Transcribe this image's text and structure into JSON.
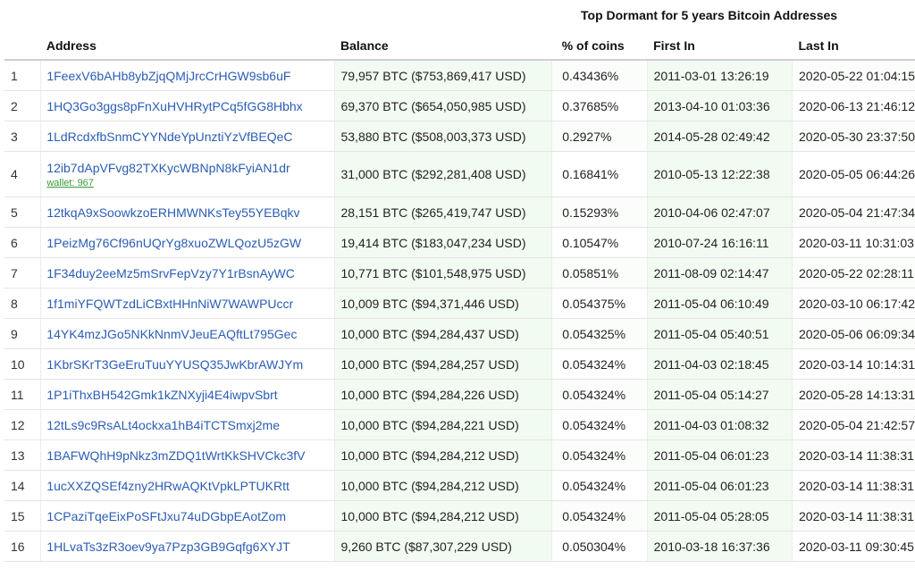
{
  "title": "Top Dormant for 5 years Bitcoin Addresses",
  "columns": {
    "address": "Address",
    "balance": "Balance",
    "pct": "% of coins",
    "first_in": "First In",
    "last_in": "Last In"
  },
  "rows": [
    {
      "idx": "1",
      "address": "1FeexV6bAHb8ybZjqQMjJrcCrHGW9sb6uF",
      "wallet": "",
      "balance": "79,957 BTC ($753,869,417 USD)",
      "pct": "0.43436%",
      "first_in": "2011-03-01 13:26:19",
      "last_in": "2020-05-22 01:04:15"
    },
    {
      "idx": "2",
      "address": "1HQ3Go3ggs8pFnXuHVHRytPCq5fGG8Hbhx",
      "wallet": "",
      "balance": "69,370 BTC ($654,050,985 USD)",
      "pct": "0.37685%",
      "first_in": "2013-04-10 01:03:36",
      "last_in": "2020-06-13 21:46:12"
    },
    {
      "idx": "3",
      "address": "1LdRcdxfbSnmCYYNdeYpUnztiYzVfBEQeC",
      "wallet": "",
      "balance": "53,880 BTC ($508,003,373 USD)",
      "pct": "0.2927%",
      "first_in": "2014-05-28 02:49:42",
      "last_in": "2020-05-30 23:37:50"
    },
    {
      "idx": "4",
      "address": "12ib7dApVFvg82TXKycWBNpN8kFyiAN1dr",
      "wallet": "wallet: 967",
      "balance": "31,000 BTC ($292,281,408 USD)",
      "pct": "0.16841%",
      "first_in": "2010-05-13 12:22:38",
      "last_in": "2020-05-05 06:44:26"
    },
    {
      "idx": "5",
      "address": "12tkqA9xSoowkzoERHMWNKsTey55YEBqkv",
      "wallet": "",
      "balance": "28,151 BTC ($265,419,747 USD)",
      "pct": "0.15293%",
      "first_in": "2010-04-06 02:47:07",
      "last_in": "2020-05-04 21:47:34"
    },
    {
      "idx": "6",
      "address": "1PeizMg76Cf96nUQrYg8xuoZWLQozU5zGW",
      "wallet": "",
      "balance": "19,414 BTC ($183,047,234 USD)",
      "pct": "0.10547%",
      "first_in": "2010-07-24 16:16:11",
      "last_in": "2020-03-11 10:31:03"
    },
    {
      "idx": "7",
      "address": "1F34duy2eeMz5mSrvFepVzy7Y1rBsnAyWC",
      "wallet": "",
      "balance": "10,771 BTC ($101,548,975 USD)",
      "pct": "0.05851%",
      "first_in": "2011-08-09 02:14:47",
      "last_in": "2020-05-22 02:28:11"
    },
    {
      "idx": "8",
      "address": "1f1miYFQWTzdLiCBxtHHnNiW7WAWPUccr",
      "wallet": "",
      "balance": "10,009 BTC ($94,371,446 USD)",
      "pct": "0.054375%",
      "first_in": "2011-05-04 06:10:49",
      "last_in": "2020-03-10 06:17:42"
    },
    {
      "idx": "9",
      "address": "14YK4mzJGo5NKkNnmVJeuEAQftLt795Gec",
      "wallet": "",
      "balance": "10,000 BTC ($94,284,437 USD)",
      "pct": "0.054325%",
      "first_in": "2011-05-04 05:40:51",
      "last_in": "2020-05-06 06:09:34"
    },
    {
      "idx": "10",
      "address": "1KbrSKrT3GeEruTuuYYUSQ35JwKbrAWJYm",
      "wallet": "",
      "balance": "10,000 BTC ($94,284,257 USD)",
      "pct": "0.054324%",
      "first_in": "2011-04-03 02:18:45",
      "last_in": "2020-03-14 10:14:31"
    },
    {
      "idx": "11",
      "address": "1P1iThxBH542Gmk1kZNXyji4E4iwpvSbrt",
      "wallet": "",
      "balance": "10,000 BTC ($94,284,226 USD)",
      "pct": "0.054324%",
      "first_in": "2011-05-04 05:14:27",
      "last_in": "2020-05-28 14:13:31"
    },
    {
      "idx": "12",
      "address": "12tLs9c9RsALt4ockxa1hB4iTCTSmxj2me",
      "wallet": "",
      "balance": "10,000 BTC ($94,284,221 USD)",
      "pct": "0.054324%",
      "first_in": "2011-04-03 01:08:32",
      "last_in": "2020-05-04 21:42:57"
    },
    {
      "idx": "13",
      "address": "1BAFWQhH9pNkz3mZDQ1tWrtKkSHVCkc3fV",
      "wallet": "",
      "balance": "10,000 BTC ($94,284,212 USD)",
      "pct": "0.054324%",
      "first_in": "2011-05-04 06:01:23",
      "last_in": "2020-03-14 11:38:31"
    },
    {
      "idx": "14",
      "address": "1ucXXZQSEf4zny2HRwAQKtVpkLPTUKRtt",
      "wallet": "",
      "balance": "10,000 BTC ($94,284,212 USD)",
      "pct": "0.054324%",
      "first_in": "2011-05-04 06:01:23",
      "last_in": "2020-03-14 11:38:31"
    },
    {
      "idx": "15",
      "address": "1CPaziTqeEixPoSFtJxu74uDGbpEAotZom",
      "wallet": "",
      "balance": "10,000 BTC ($94,284,212 USD)",
      "pct": "0.054324%",
      "first_in": "2011-05-04 05:28:05",
      "last_in": "2020-03-14 11:38:31"
    },
    {
      "idx": "16",
      "address": "1HLvaTs3zR3oev9ya7Pzp3GB9Gqfg6XYJT",
      "wallet": "",
      "balance": "9,260 BTC ($87,307,229 USD)",
      "pct": "0.050304%",
      "first_in": "2010-03-18 16:37:36",
      "last_in": "2020-03-11 09:30:45"
    }
  ]
}
